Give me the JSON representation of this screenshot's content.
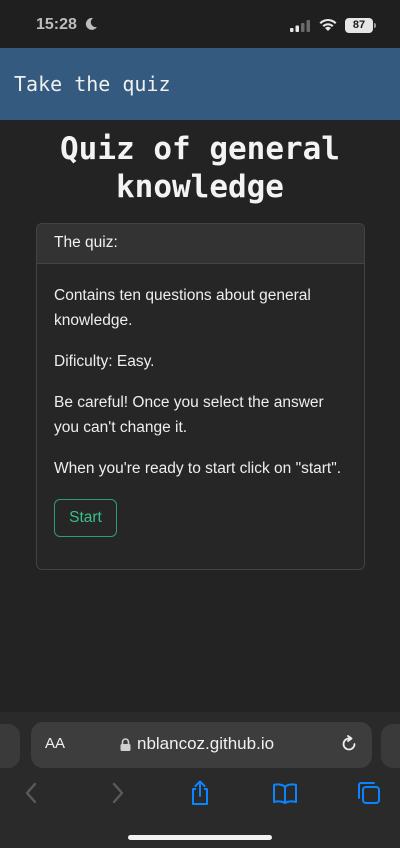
{
  "status_bar": {
    "time": "15:28",
    "battery": "87"
  },
  "header": {
    "title": "Take the quiz"
  },
  "page": {
    "title": "Quiz of general knowledge"
  },
  "card": {
    "header": "The quiz:",
    "paragraphs": [
      "Contains ten questions about general knowledge.",
      "Dificulty: Easy.",
      "Be careful! Once you select the answer you can't change it.",
      "When you're ready to start click on \"start\"."
    ],
    "start_label": "Start"
  },
  "browser": {
    "aa_label": "AA",
    "url": "nblancoz.github.io"
  },
  "colors": {
    "header_bg": "#345a80",
    "page_bg": "#232323",
    "accent_green": "#3bbf87",
    "ios_blue": "#0a84ff"
  },
  "icons": {
    "status": [
      "moon-icon",
      "signal-icon",
      "wifi-icon",
      "battery-icon"
    ],
    "toolbar": [
      "back-icon",
      "forward-icon",
      "share-icon",
      "bookmarks-icon",
      "tabs-icon"
    ]
  }
}
